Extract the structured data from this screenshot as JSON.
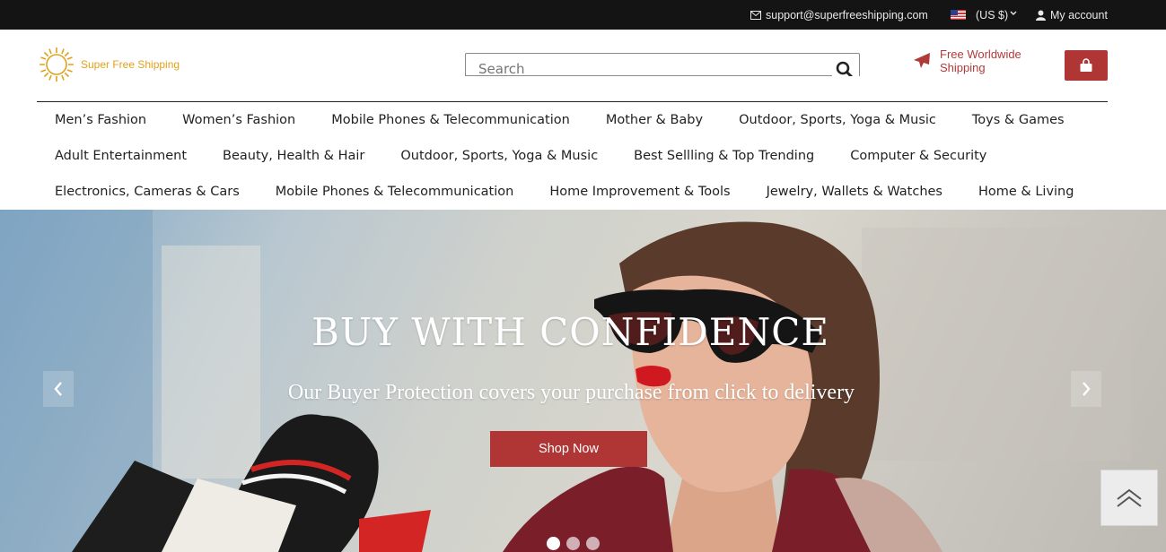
{
  "topbar": {
    "email": "support@superfreeshipping.com",
    "currency": "(US $)",
    "account": "My account"
  },
  "header": {
    "logo_text": "Super Free Shipping",
    "search_placeholder": "Search",
    "shipping_line1": "Free Worldwide",
    "shipping_line2": "Shipping"
  },
  "nav": {
    "row1": [
      "Men’s Fashion",
      "Women’s Fashion",
      "Mobile Phones & Telecommunication",
      "Mother & Baby",
      "Outdoor, Sports, Yoga & Music",
      "Toys & Games"
    ],
    "row2": [
      "Adult Entertainment",
      "Beauty, Health & Hair",
      "Outdoor, Sports, Yoga & Music",
      "Best Sellling & Top Trending",
      "Computer & Security"
    ],
    "row3": [
      "Electronics, Cameras & Cars",
      "Mobile Phones & Telecommunication",
      "Home Improvement & Tools",
      "Jewelry, Wallets & Watches",
      "Home & Living"
    ]
  },
  "hero": {
    "title": "BUY WITH CONFIDENCE",
    "subtitle": "Our Buyer Protection covers your purchase from click to delivery",
    "button": "Shop Now",
    "slide_count": 3,
    "active_slide": 1
  },
  "colors": {
    "accent": "#b03535",
    "topbar": "#141414",
    "logo": "#e0a21c"
  }
}
